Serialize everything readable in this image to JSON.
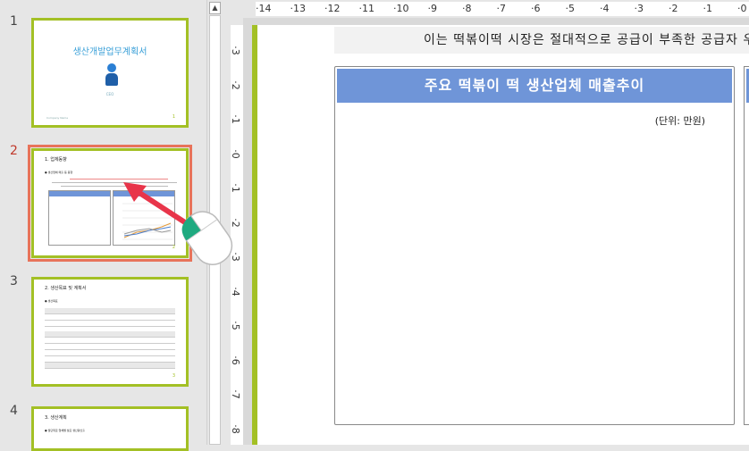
{
  "slides": [
    {
      "number": "1",
      "title": "생산개발업무계획서",
      "subtitle": "CEO",
      "footer": "Company Name",
      "page": "1"
    },
    {
      "number": "2",
      "title": "1. 업체동향",
      "bullet": "● 생산업체 매출 등 동향",
      "page": "2",
      "left_caption": "주요 떡볶이 떡 생산업체 매출추이",
      "right_caption": "주요 떡볶이 떡 생산업체 매출추이"
    },
    {
      "number": "3",
      "title": "2. 생산목표 및 계획서",
      "bullet": "● 생산목표",
      "page": "3"
    },
    {
      "number": "4",
      "title": "3. 생산계획",
      "bullet": "● 월단위로 업체별 필요 생산량산출"
    }
  ],
  "ruler": {
    "h": [
      "·14",
      "·13",
      "·12",
      "·11",
      "·10",
      "·9",
      "·8",
      "·7",
      "·6",
      "·5",
      "·4",
      "·3",
      "·2",
      "·1",
      "·0",
      "·1"
    ],
    "v": [
      "·3",
      "·2",
      "·1",
      "·0",
      "·1",
      "·2",
      "·3",
      "·4",
      "·5",
      "·6",
      "·7",
      "·8"
    ]
  },
  "editor": {
    "body_text": "이는 떡볶이떡 시장은 절대적으로 공급이 부족한 공급자 우선",
    "chart_title": "주요 떡볶이 떡 생산업체 매출추이",
    "unit_label": "(단위: 만원)"
  },
  "scrollbar": {
    "up_arrow": "▲"
  },
  "colors": {
    "accent_green": "#a3c025",
    "selection": "#e8735a",
    "header_blue": "#6f95d8",
    "arrow_red": "#e8354a",
    "cursor_teal": "#1faa80"
  }
}
